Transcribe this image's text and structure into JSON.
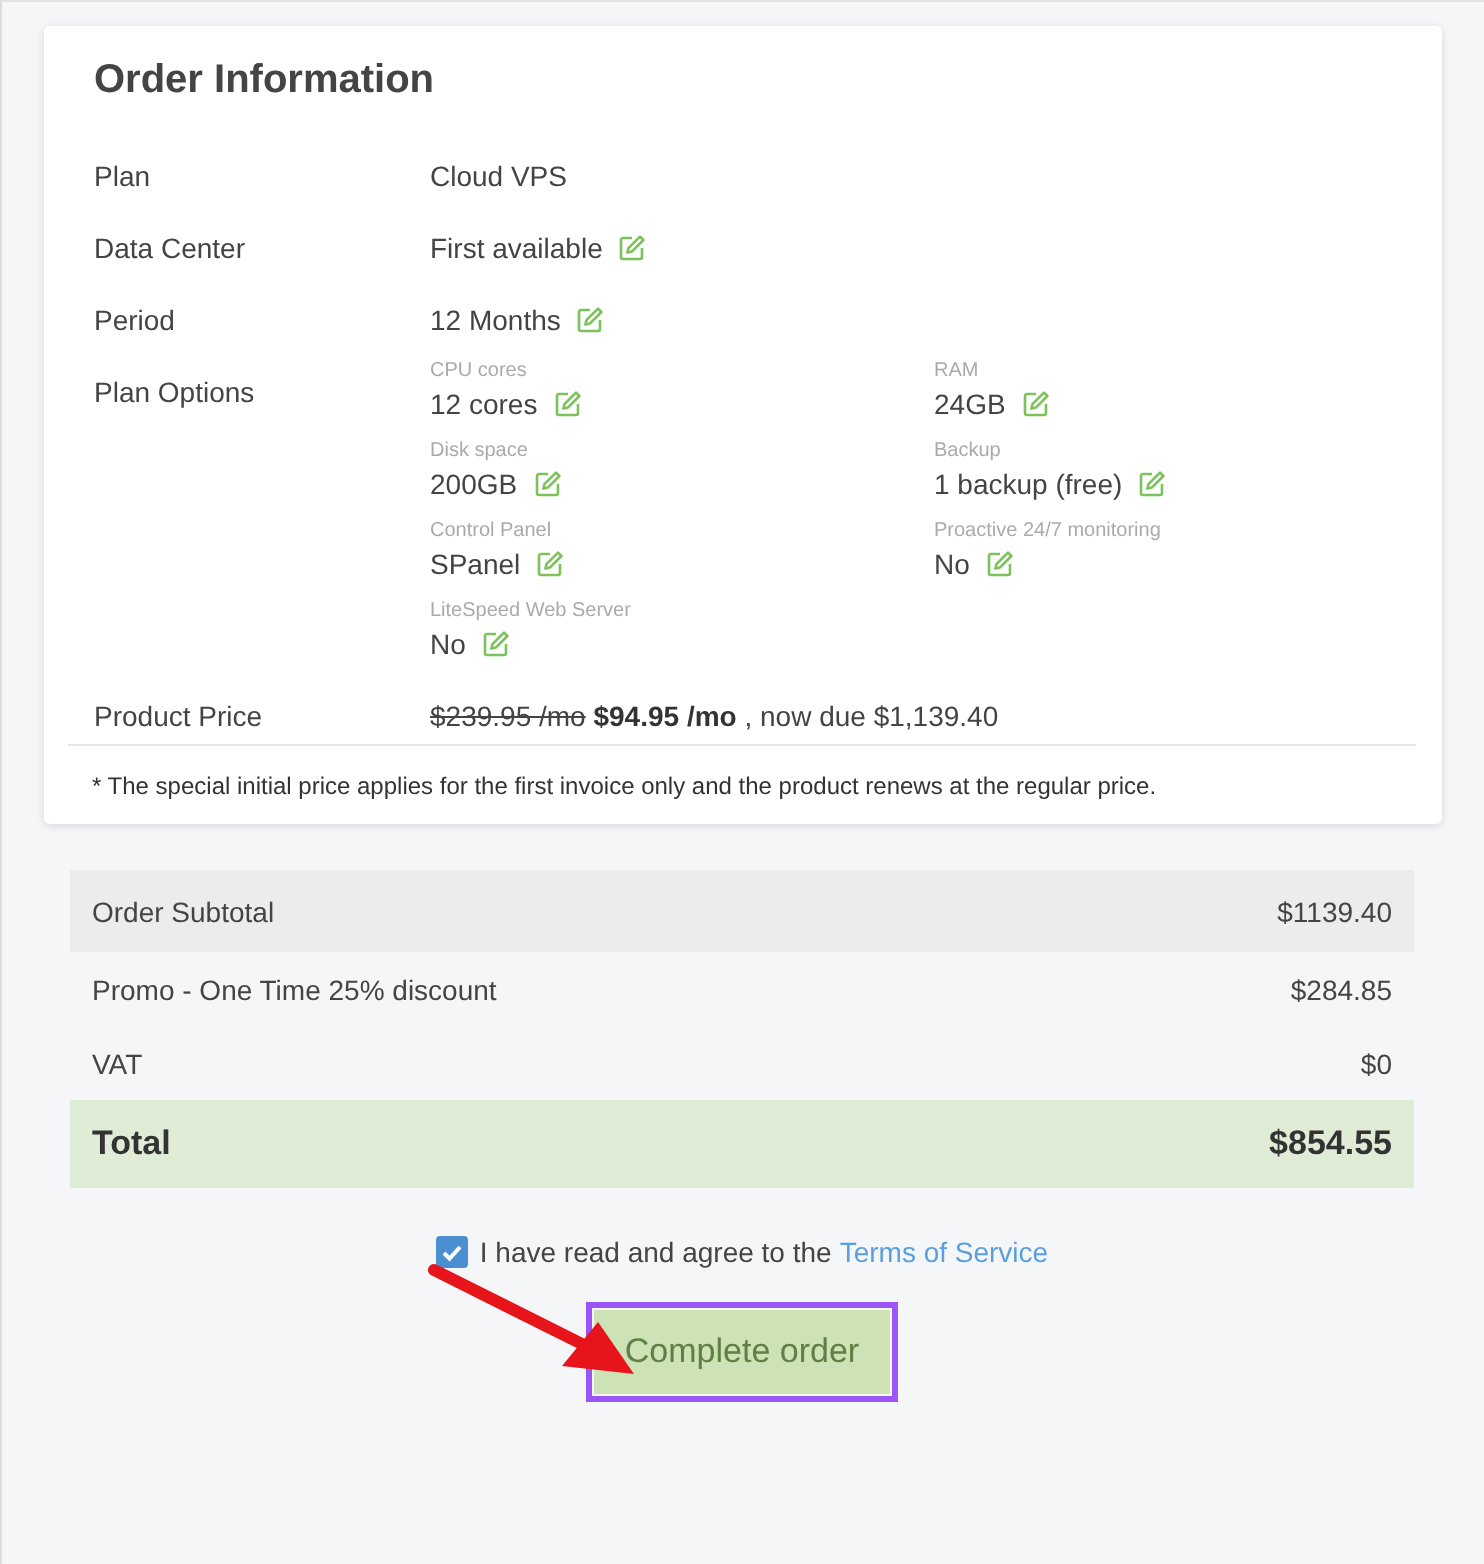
{
  "order_info": {
    "title": "Order Information",
    "rows": [
      {
        "kind": "text",
        "label": "Plan",
        "value": "Cloud VPS",
        "editable": false
      },
      {
        "kind": "text",
        "label": "Data Center",
        "value": "First available",
        "editable": true
      },
      {
        "kind": "text",
        "label": "Period",
        "value": "12 Months",
        "editable": true
      },
      {
        "kind": "options",
        "label": "Plan Options",
        "options": [
          {
            "label": "CPU cores",
            "value": "12 cores",
            "editable": true
          },
          {
            "label": "RAM",
            "value": "24GB",
            "editable": true
          },
          {
            "label": "Disk space",
            "value": "200GB",
            "editable": true
          },
          {
            "label": "Backup",
            "value": "1 backup (free)",
            "editable": true
          },
          {
            "label": "Control Panel",
            "value": "SPanel",
            "editable": true
          },
          {
            "label": "Proactive 24/7 monitoring",
            "value": "No",
            "editable": true
          },
          {
            "label": "LiteSpeed Web Server",
            "value": "No",
            "editable": true
          }
        ]
      },
      {
        "kind": "price",
        "label": "Product Price",
        "old_price": "$239.95 /mo",
        "new_price": "$94.95 /mo",
        "due": ", now due $1,139.40"
      }
    ],
    "note": "* The special initial price applies for the first invoice only and the product renews at the regular price."
  },
  "summary": [
    {
      "kind": "subtotal",
      "label": "Order Subtotal",
      "amount": "$1139.40"
    },
    {
      "kind": "line",
      "label": "Promo - One Time 25% discount",
      "amount": "$284.85"
    },
    {
      "kind": "line",
      "label": "VAT",
      "amount": "$0"
    },
    {
      "kind": "total",
      "label": "Total",
      "amount": "$854.55"
    }
  ],
  "agreement": {
    "checked": true,
    "text": "I have read and agree to the",
    "link": "Terms of Service"
  },
  "button": {
    "label": "Complete order",
    "highlighted": true
  }
}
